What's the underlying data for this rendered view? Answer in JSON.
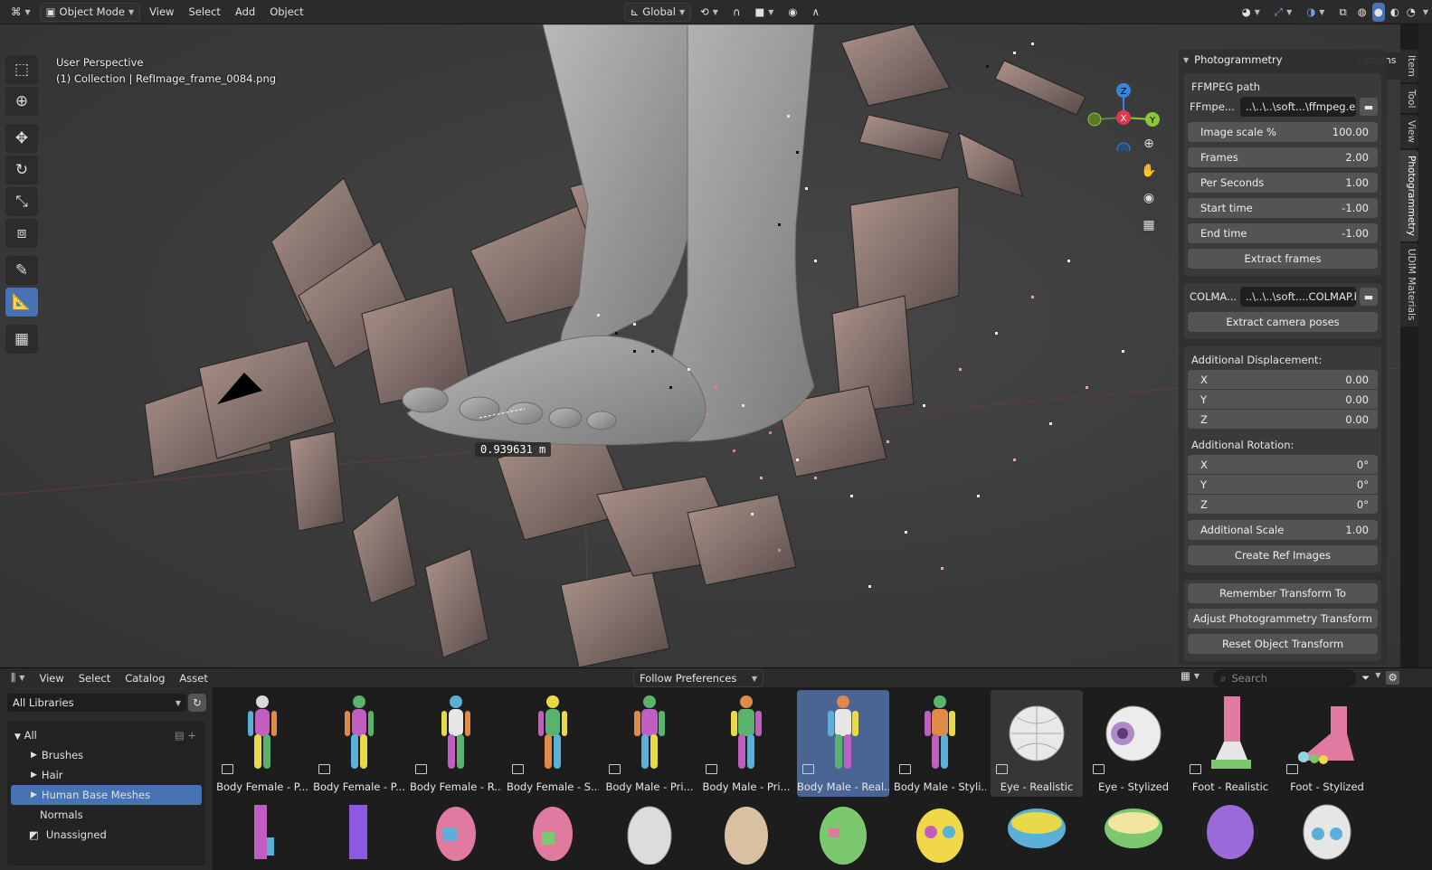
{
  "topbar": {
    "mode": "Object Mode",
    "menus": [
      "View",
      "Select",
      "Add",
      "Object"
    ],
    "transform_orientation": "Global",
    "options_label": "Options"
  },
  "viewport": {
    "perspective": "User Perspective",
    "collection": "(1) Collection | RefImage_frame_0084.png",
    "measurement": "0.939631 m",
    "gizmo": {
      "z": "Z",
      "x": "X",
      "y": "Y"
    }
  },
  "npanel": {
    "title": "Photogrammetry",
    "ffmpeg_section": "FFMPEG path",
    "ffmpeg_label": "FFmpe...",
    "ffmpeg_value": "..\\..\\..\\soft...\\ffmpeg.exe",
    "fields": [
      {
        "label": "Image scale %",
        "value": "100.00"
      },
      {
        "label": "Frames",
        "value": "2.00"
      },
      {
        "label": "Per Seconds",
        "value": "1.00"
      },
      {
        "label": "Start time",
        "value": "-1.00"
      },
      {
        "label": "End time",
        "value": "-1.00"
      }
    ],
    "extract_frames": "Extract frames",
    "colmap_label": "COLMA...",
    "colmap_value": "..\\..\\..\\soft....COLMAP.bat",
    "extract_poses": "Extract camera poses",
    "displacement_title": "Additional Displacement:",
    "displacement": [
      {
        "label": "X",
        "value": "0.00"
      },
      {
        "label": "Y",
        "value": "0.00"
      },
      {
        "label": "Z",
        "value": "0.00"
      }
    ],
    "rotation_title": "Additional Rotation:",
    "rotation": [
      {
        "label": "X",
        "value": "0°"
      },
      {
        "label": "Y",
        "value": "0°"
      },
      {
        "label": "Z",
        "value": "0°"
      }
    ],
    "scale": {
      "label": "Additional Scale",
      "value": "1.00"
    },
    "create_ref": "Create Ref Images",
    "remember": "Remember Transform To",
    "adjust": "Adjust Photogrammetry Transform",
    "reset": "Reset Object Transform"
  },
  "vtabs": [
    "Item",
    "Tool",
    "View",
    "Photogrammetry",
    "UDIM Materials"
  ],
  "asset_browser": {
    "menus": [
      "View",
      "Select",
      "Catalog",
      "Asset"
    ],
    "import_method": "Follow Preferences",
    "search_placeholder": "Search",
    "library": "All Libraries",
    "tree": {
      "all": "All",
      "items": [
        "Brushes",
        "Hair",
        "Human Base Meshes",
        "Normals",
        "Unassigned"
      ]
    },
    "assets": [
      "Body Female - P...",
      "Body Female - P...",
      "Body Female - R...",
      "Body Female - S...",
      "Body Male - Pri...",
      "Body Male - Pri...",
      "Body Male - Real...",
      "Body Male - Styli...",
      "Eye - Realistic",
      "Eye - Stylized",
      "Foot - Realistic",
      "Foot - Stylized"
    ]
  },
  "colors": {
    "accent": "#4772b3",
    "axis_x": "#e0384e",
    "axis_y": "#8cc63f",
    "axis_z": "#3b84de"
  }
}
